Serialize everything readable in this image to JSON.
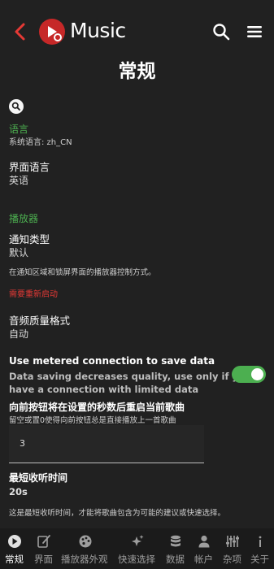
{
  "header": {
    "app_title": "Music",
    "icons": {
      "back": "back-arrow-icon",
      "logo": "app-logo-icon",
      "search": "search-icon",
      "menu": "menu-icon"
    },
    "accent_color": "#c62828"
  },
  "page_title": "常规",
  "language": {
    "section_label": "语言",
    "system_language": "系统语言: zh_CN",
    "ui_language_title": "界面语言",
    "ui_language_value": "英语"
  },
  "player": {
    "section_label": "播放器",
    "notification_type_title": "通知类型",
    "notification_type_value": "默认",
    "notification_description": "在通知区域和锁屏界面的播放器控制方式。",
    "restart_required": "需要重新启动",
    "audio_quality_title": "音频质量格式",
    "audio_quality_value": "自动",
    "metered_title": "Use metered connection to save data",
    "metered_description_line1": "Data saving decreases quality, use only if you",
    "metered_description_line2": "have a connection with limited data",
    "metered_enabled": true,
    "restart_song_title": "向前按钮将在设置的秒数后重启当前歌曲",
    "restart_song_hint": "留空或置0使得向前按钮总是直接播放上一首歌曲",
    "restart_song_value": "3",
    "min_listen_title": "最短收听时间",
    "min_listen_value": "20s",
    "min_listen_description": "这是最短收听时间，才能将歌曲包含为可能的建议或快速选择。"
  },
  "switch_color": "#4caf50",
  "nav": [
    {
      "label": "常规",
      "icon": "app-logo-icon",
      "active": true
    },
    {
      "label": "界面",
      "icon": "edit-icon",
      "active": false
    },
    {
      "label": "播放器外观",
      "icon": "palette-icon",
      "active": false
    },
    {
      "label": "快速选择",
      "icon": "sparkles-icon",
      "active": false
    },
    {
      "label": "数据",
      "icon": "database-icon",
      "active": false
    },
    {
      "label": "帐户",
      "icon": "person-icon",
      "active": false
    },
    {
      "label": "杂项",
      "icon": "sliders-icon",
      "active": false
    },
    {
      "label": "关于",
      "icon": "info-icon",
      "active": false
    }
  ]
}
